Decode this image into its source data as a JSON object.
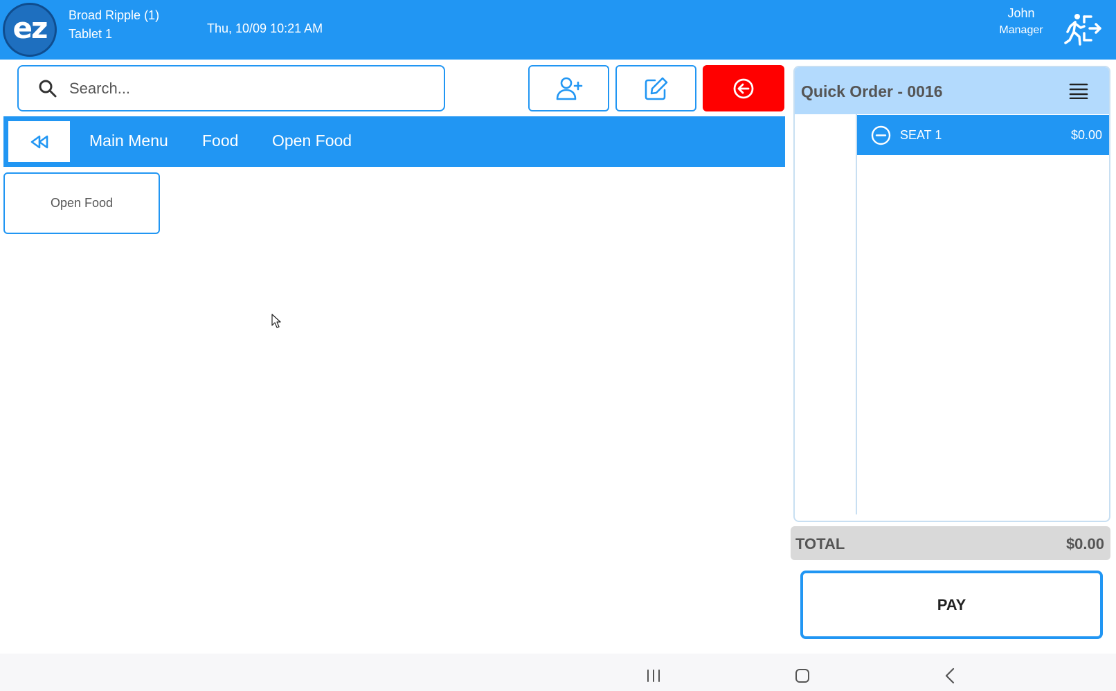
{
  "header": {
    "logo_text": "ez",
    "store_name": "Broad Ripple (1)",
    "device_name": "Tablet 1",
    "datetime": "Thu, 10/09 10:21 AM",
    "user_name": "John",
    "user_role": "Manager",
    "logout_icon": "person-exit-icon"
  },
  "search": {
    "placeholder": "Search...",
    "value": "",
    "icon": "search-icon"
  },
  "actions": {
    "add_customer_icon": "user-plus-icon",
    "edit_icon": "edit-icon",
    "exit_order_icon": "circle-arrow-left-icon"
  },
  "breadcrumb": {
    "back_icon": "rewind-icon",
    "items": [
      {
        "label": "Main Menu"
      },
      {
        "label": "Food"
      },
      {
        "label": "Open Food"
      }
    ]
  },
  "items": [
    {
      "label": "Open Food"
    }
  ],
  "order": {
    "title": "Quick Order - 0016",
    "menu_icon": "hamburger-icon",
    "seats": [
      {
        "label": "SEAT 1",
        "amount": "$0.00",
        "icon": "minus-circle-icon"
      }
    ],
    "total_label": "TOTAL",
    "total_amount": "$0.00",
    "pay_label": "PAY"
  },
  "colors": {
    "primary": "#2196f3",
    "danger": "#ff0000",
    "panel_header": "#b3dafd",
    "total_bg": "#d9d9d9"
  }
}
